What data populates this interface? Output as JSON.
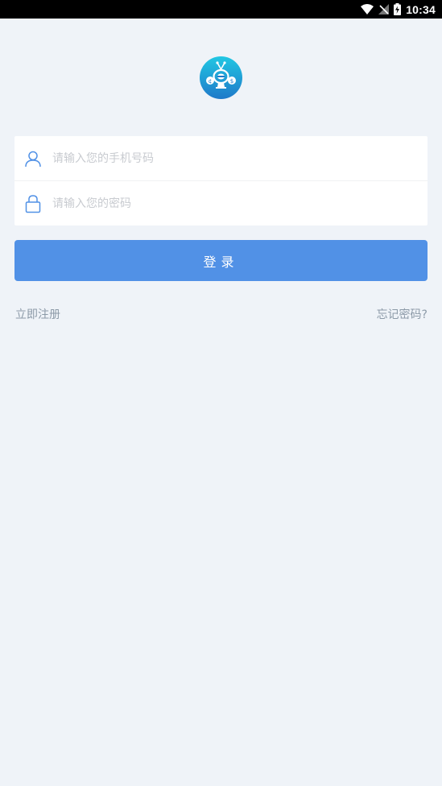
{
  "status_bar": {
    "time": "10:34",
    "icons": [
      "wifi-icon",
      "no-signal-icon",
      "battery-charging-icon"
    ]
  },
  "logo": {
    "icon": "app-logo"
  },
  "login_form": {
    "phone": {
      "placeholder": "请输入您的手机号码",
      "value": "",
      "icon": "user-icon"
    },
    "password": {
      "placeholder": "请输入您的密码",
      "value": "",
      "icon": "lock-icon"
    },
    "submit_label": "登录"
  },
  "links": {
    "register": "立即注册",
    "forgot_password": "忘记密码?"
  },
  "colors": {
    "background": "#eff3f8",
    "primary": "#5191e6",
    "link": "#8c9aa8",
    "placeholder": "#c8cbd0",
    "icon": "#5191e6"
  }
}
